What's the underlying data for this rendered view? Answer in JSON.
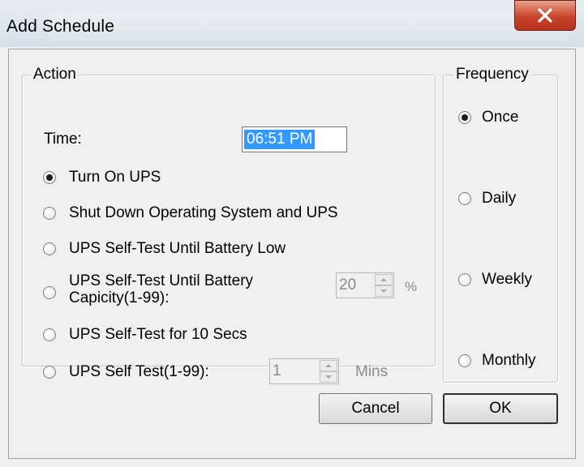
{
  "window": {
    "title": "Add Schedule",
    "close_icon": "close-icon"
  },
  "action": {
    "label": "Action",
    "time_label": "Time:",
    "time_value": "06:51 PM",
    "options": [
      {
        "label": "Turn On UPS",
        "checked": true
      },
      {
        "label": "Shut Down Operating System and UPS",
        "checked": false
      },
      {
        "label": "UPS Self-Test Until Battery Low",
        "checked": false
      },
      {
        "label_line1": "UPS Self-Test Until Battery",
        "label_line2": "Capicity(1-99):",
        "checked": false,
        "value": "20",
        "unit": "%"
      },
      {
        "label": "UPS Self-Test for 10 Secs",
        "checked": false
      },
      {
        "label": "UPS Self Test(1-99):",
        "checked": false,
        "value": "1",
        "unit": "Mins"
      }
    ]
  },
  "frequency": {
    "label": "Frequency",
    "options": [
      {
        "label": "Once",
        "checked": true
      },
      {
        "label": "Daily",
        "checked": false
      },
      {
        "label": "Weekly",
        "checked": false
      },
      {
        "label": "Monthly",
        "checked": false
      }
    ]
  },
  "buttons": {
    "cancel": "Cancel",
    "ok": "OK"
  },
  "colors": {
    "selection": "#3399ff",
    "close_button": "#c9442d"
  }
}
